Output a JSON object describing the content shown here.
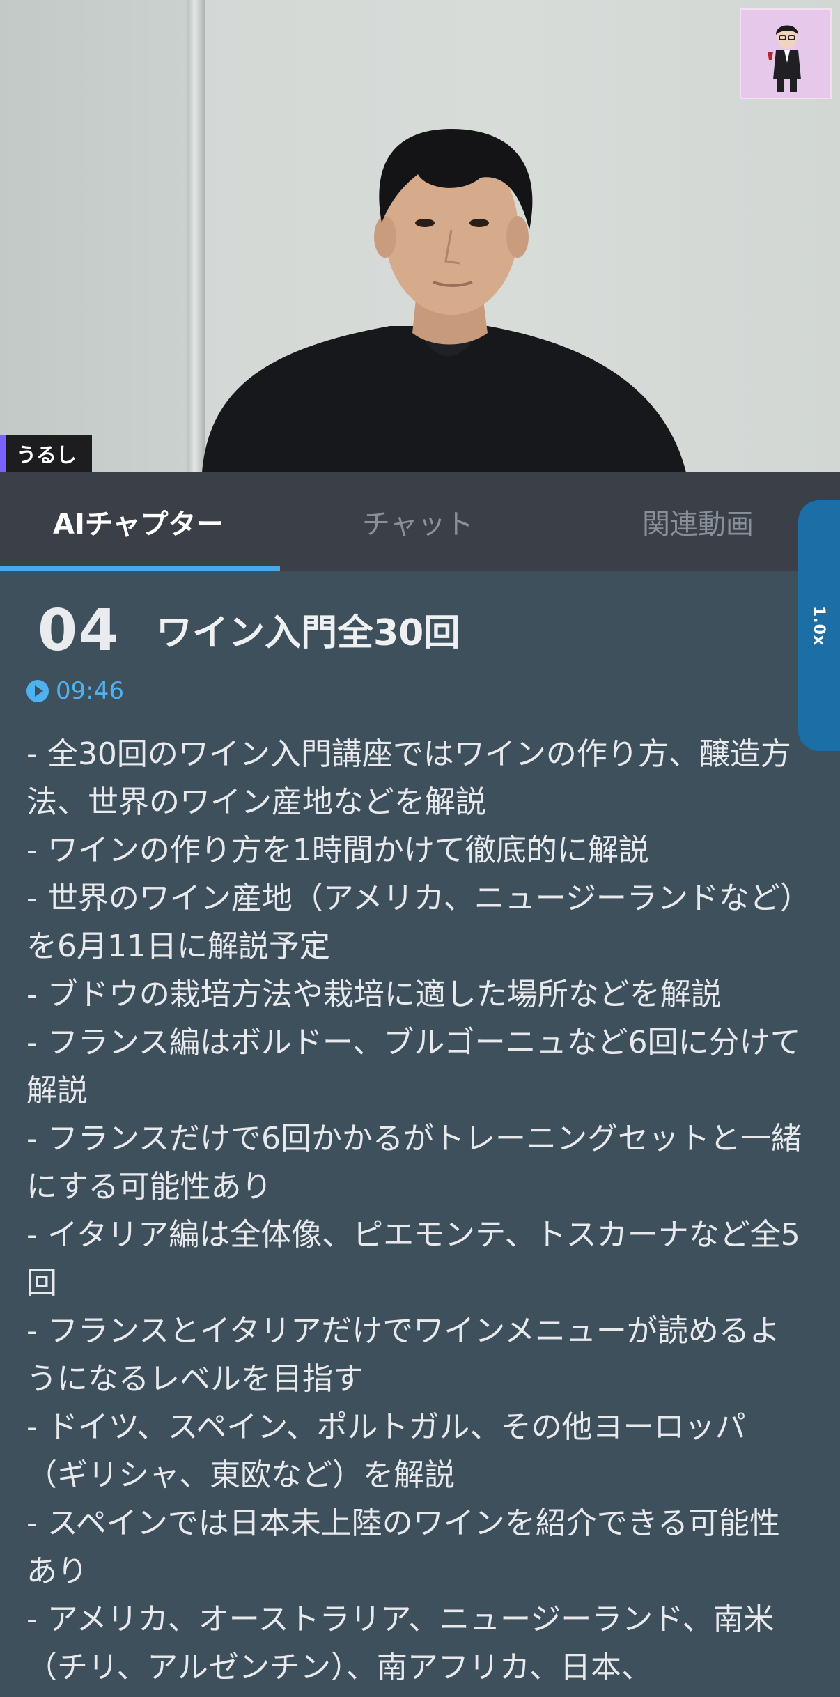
{
  "video": {
    "speaker_name": "うるし"
  },
  "tabs": [
    {
      "label": "AIチャプター",
      "active": true
    },
    {
      "label": "チャット",
      "active": false
    },
    {
      "label": "関連動画",
      "active": false
    }
  ],
  "speed": {
    "label": "1.0x"
  },
  "chapter": {
    "number": "04",
    "title": "ワイン入門全30回",
    "timestamp": "09:46",
    "summary": [
      "- 全30回のワイン入門講座ではワインの作り方、醸造方法、世界のワイン産地などを解説",
      "- ワインの作り方を1時間かけて徹底的に解説",
      "- 世界のワイン産地（アメリカ、ニュージーランドなど）を6月11日に解説予定",
      "- ブドウの栽培方法や栽培に適した場所などを解説",
      "- フランス編はボルドー、ブルゴーニュなど6回に分けて解説",
      "- フランスだけで6回かかるがトレーニングセットと一緒にする可能性あり",
      "- イタリア編は全体像、ピエモンテ、トスカーナなど全5回",
      "- フランスとイタリアだけでワインメニューが読めるようになるレベルを目指す",
      "- ドイツ、スペイン、ポルトガル、その他ヨーロッパ（ギリシャ、東欧など）を解説",
      "- スペインでは日本未上陸のワインを紹介できる可能性あり",
      "- アメリカ、オーストラリア、ニュージーランド、南米（チリ、アルゼンチン）、南アフリカ、日本、"
    ]
  },
  "colors": {
    "accent": "#4aa8ee",
    "speaker_bar": "#7b62ff",
    "content_bg": "#3f505d",
    "tabbar_bg": "#3a3f48",
    "speed_pill": "#1b6fa6"
  }
}
